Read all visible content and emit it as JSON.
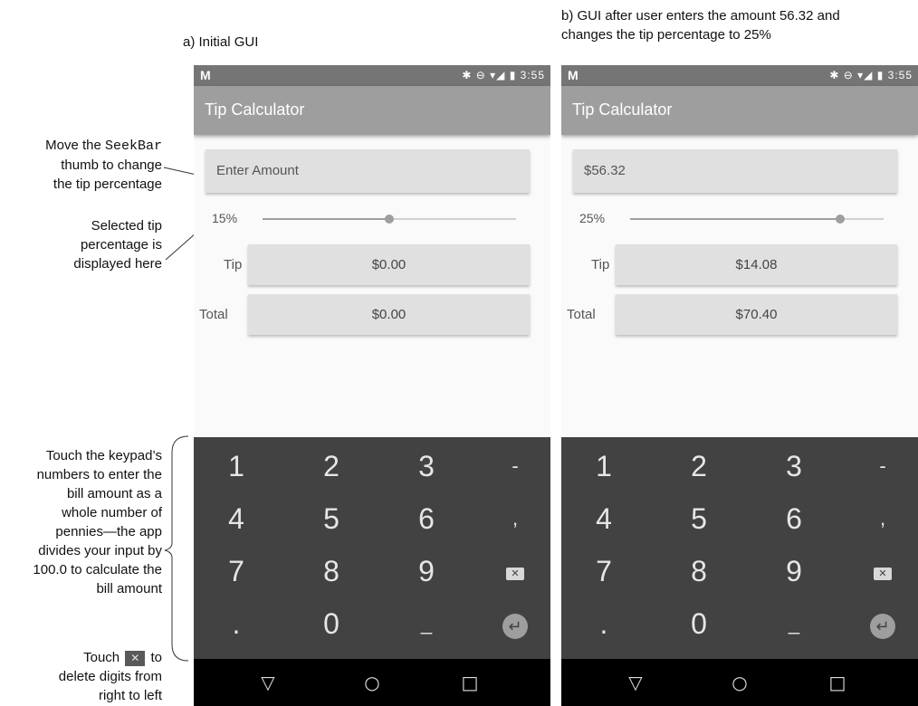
{
  "captions": {
    "a": "a) Initial GUI",
    "b_line1": "b) GUI after user enters the amount 56.32 and",
    "b_line2": "changes the tip percentage to 25%"
  },
  "annotations": {
    "seekbar": {
      "line1_pre": "Move the ",
      "line1_code": "SeekBar",
      "line2": "thumb to change",
      "line3": "the tip percentage"
    },
    "percent": {
      "line1": "Selected tip",
      "line2": "percentage is",
      "line3": "displayed here"
    },
    "keypad": {
      "lines": [
        "Touch the keypad’s",
        "numbers to enter the",
        "bill amount as a",
        "whole number of",
        "pennies—the app",
        "divides your input by",
        "100.0 to calculate the",
        "bill amount"
      ]
    },
    "delete": {
      "line1_pre": "Touch",
      "line1_post": "to",
      "line2": "delete digits from",
      "line3": "right to left",
      "icon": "✕"
    }
  },
  "phones": [
    {
      "status": {
        "m_icon": "M",
        "icons": "✱ ⊖ ▾◢ ▮",
        "time": "3:55"
      },
      "app_title": "Tip Calculator",
      "amount_text": "Enter Amount",
      "percent_label": "15%",
      "slider_fraction": 0.5,
      "tip_label": "Tip",
      "tip_value": "$0.00",
      "total_label": "Total",
      "total_value": "$0.00"
    },
    {
      "status": {
        "m_icon": "M",
        "icons": "✱ ⊖ ▾◢ ▮",
        "time": "3:55"
      },
      "app_title": "Tip Calculator",
      "amount_text": "$56.32",
      "percent_label": "25%",
      "slider_fraction": 0.83,
      "tip_label": "Tip",
      "tip_value": "$14.08",
      "total_label": "Total",
      "total_value": "$70.40"
    }
  ],
  "keypad_keys": [
    "1",
    "2",
    "3",
    "-",
    "4",
    "5",
    "6",
    ",",
    "7",
    "8",
    "9",
    "backspace",
    ".",
    "0",
    "_",
    "enter"
  ],
  "icons": {
    "backspace": "✕",
    "enter": "↵",
    "nav_back": "▽",
    "nav_home": "○",
    "nav_recents": "□"
  }
}
